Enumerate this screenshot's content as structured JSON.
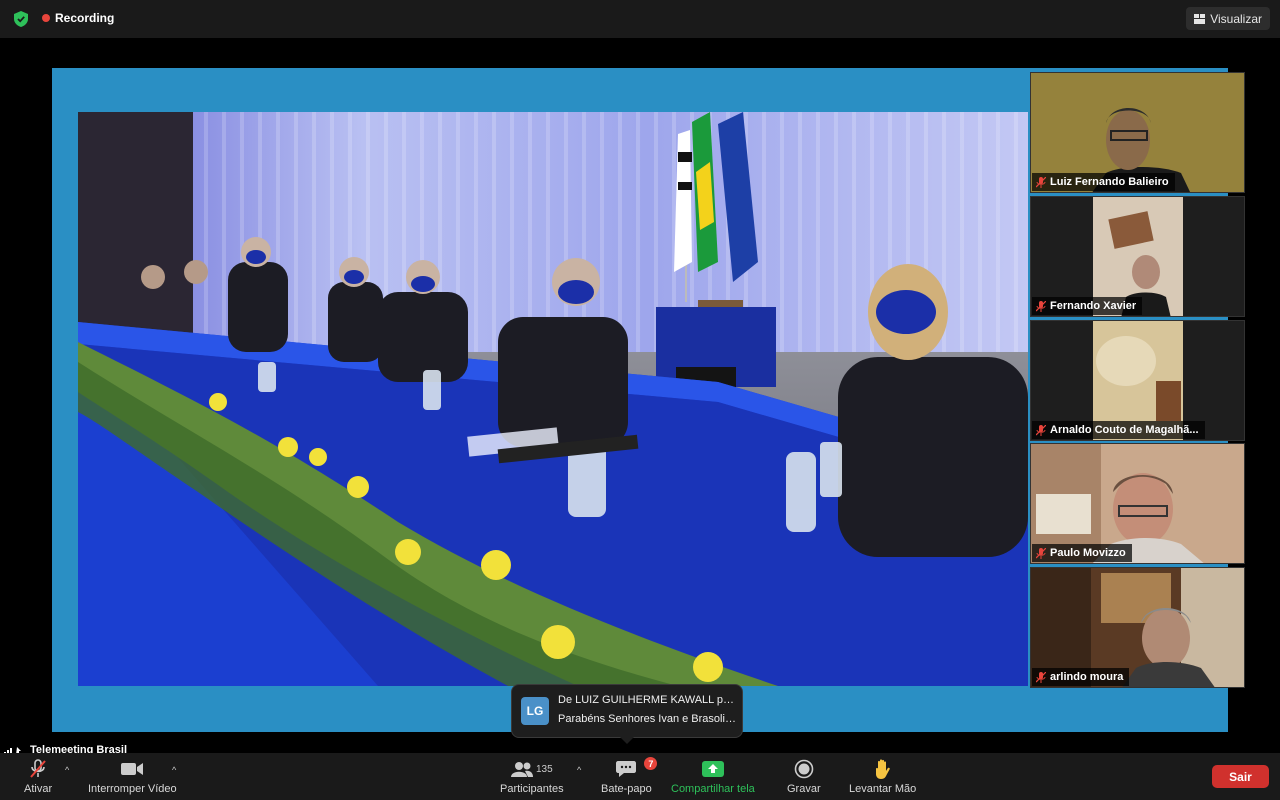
{
  "topbar": {
    "recording_label": "Recording",
    "view_label": "Visualizar"
  },
  "participants": [
    {
      "name": "Luiz Fernando Balieiro"
    },
    {
      "name": "Fernando Xavier"
    },
    {
      "name": "Arnaldo Couto de Magalhã..."
    },
    {
      "name": "Paulo Movizzo"
    },
    {
      "name": "arlindo moura"
    }
  ],
  "chat_toast": {
    "initials": "LG",
    "line1": "De LUIZ GUILHERME KAWALL par...",
    "line2": "Parabéns Senhores Ivan e Brasolin..."
  },
  "meeting_label": "Telemeeting Brasil",
  "toolbar": {
    "mute_label": "Ativar",
    "video_label": "Interromper Vídeo",
    "participants_label": "Participantes",
    "participants_count": "135",
    "chat_label": "Bate-papo",
    "chat_badge": "7",
    "share_label": "Compartilhar tela",
    "record_label": "Gravar",
    "raise_hand_label": "Levantar Mão",
    "leave_label": "Sair"
  },
  "colors": {
    "share_accent": "#2ec05a",
    "leave_button": "#d0312d",
    "recording_dot": "#e8453c",
    "frame_blue": "#2a8fc4"
  }
}
